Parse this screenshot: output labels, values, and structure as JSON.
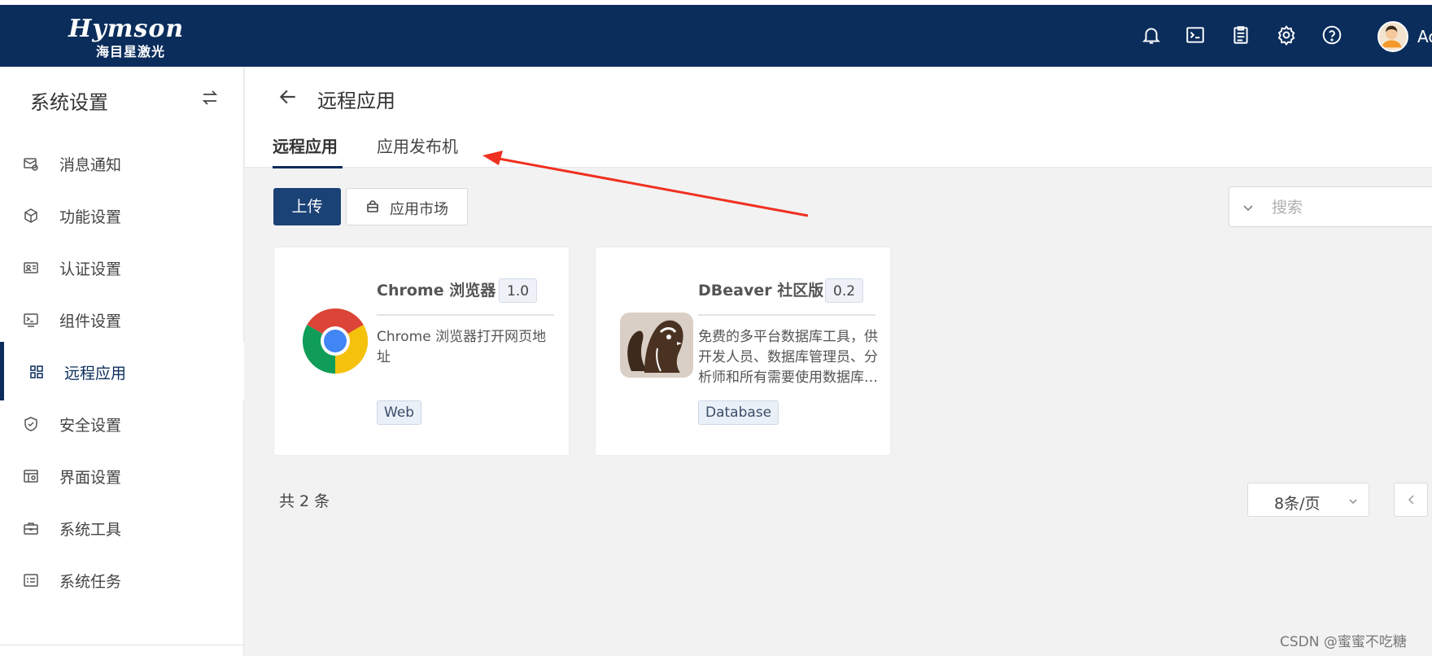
{
  "header": {
    "logo_main": "Hymson",
    "logo_sub": "海目星激光",
    "icons": [
      "bell-icon",
      "terminal-icon",
      "clipboard-icon",
      "gear-icon",
      "help-icon"
    ],
    "username": "Ac"
  },
  "sidebar": {
    "title": "系统设置",
    "items": [
      {
        "label": "消息通知",
        "icon": "message-settings-icon"
      },
      {
        "label": "功能设置",
        "icon": "cube-icon"
      },
      {
        "label": "认证设置",
        "icon": "id-card-icon"
      },
      {
        "label": "组件设置",
        "icon": "terminal-window-icon"
      },
      {
        "label": "远程应用",
        "icon": "apps-icon",
        "active": true
      },
      {
        "label": "安全设置",
        "icon": "shield-check-icon"
      },
      {
        "label": "界面设置",
        "icon": "layout-settings-icon"
      },
      {
        "label": "系统工具",
        "icon": "toolbox-icon"
      },
      {
        "label": "系统任务",
        "icon": "task-list-icon"
      }
    ]
  },
  "main": {
    "title": "远程应用",
    "tabs": [
      {
        "label": "远程应用",
        "active": true
      },
      {
        "label": "应用发布机",
        "active": false
      }
    ],
    "toolbar": {
      "upload_label": "上传",
      "market_label": "应用市场",
      "search_placeholder": "搜索"
    },
    "cards": [
      {
        "name": "Chrome 浏览器",
        "version": "1.0",
        "description": "Chrome 浏览器打开网页地址",
        "tag": "Web",
        "icon": "chrome-logo"
      },
      {
        "name": "DBeaver 社区版",
        "version": "0.2",
        "description": "免费的多平台数据库工具，供开发人员、数据库管理员、分析师和所有需要使用数据库的人使用",
        "tag": "Database",
        "icon": "dbeaver-logo"
      }
    ],
    "pagination": {
      "total_text": "共 2 条",
      "page_size": "8条/页"
    }
  },
  "colors": {
    "topbar": "#0b2d5c",
    "primary_button": "#1b4276",
    "annotation_arrow": "#f03020"
  },
  "watermark": "CSDN @蜜蜜不吃糖"
}
